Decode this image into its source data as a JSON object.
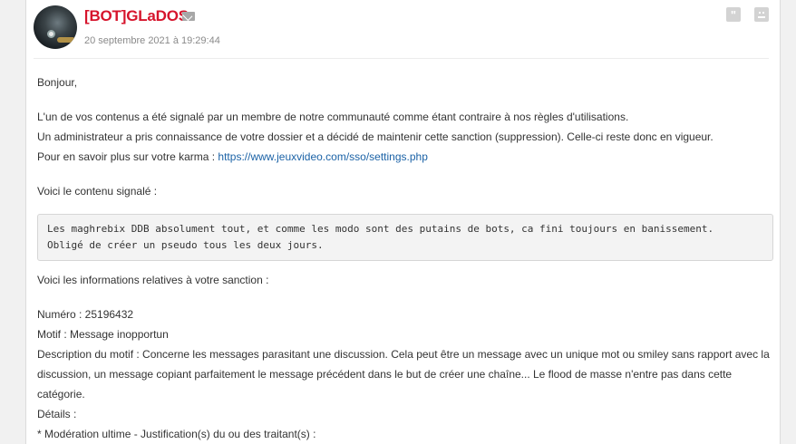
{
  "post": {
    "author": "[BOT]GLaDOS",
    "date": "20 septembre 2021 à 19:29:44",
    "quote_icon": "quote-icon",
    "alert_icon": "report-icon",
    "mail_icon": "mail-icon"
  },
  "message": {
    "greeting": "Bonjour,",
    "line1": "L'un de vos contenus a été signalé par un membre de notre communauté comme étant contraire à nos règles d'utilisations.",
    "line2": "Un administrateur a pris connaissance de votre dossier et a décidé de maintenir cette sanction (suppression). Celle-ci reste donc en vigueur.",
    "line3_prefix": "Pour en savoir plus sur votre karma : ",
    "line3_link": "https://www.jeuxvideo.com/sso/settings.php",
    "reported_intro": "Voici le contenu signalé :",
    "reported_content": "Les maghrebix DDB absolument tout, et comme les modo sont des putains de bots, ca fini toujours en banissement.\nObligé de créer un pseudo tous les deux jours.",
    "sanction_intro": "Voici les informations relatives à votre sanction :",
    "numero": "Numéro : 25196432",
    "motif": "Motif : Message inopportun",
    "description": "Description du motif : Concerne les messages parasitant une discussion. Cela peut être un message avec un unique mot ou smiley sans rapport avec la discussion, un message copiant parfaitement le message précédent dans le but de créer une chaîne... Le flood de masse n'entre pas dans cette catégorie.",
    "details": "Détails :",
    "moderation": "* Modération ultime - Justification(s) du ou des traitant(s) :"
  },
  "colors": {
    "author": "#d6142c",
    "link": "#1b62a6"
  }
}
